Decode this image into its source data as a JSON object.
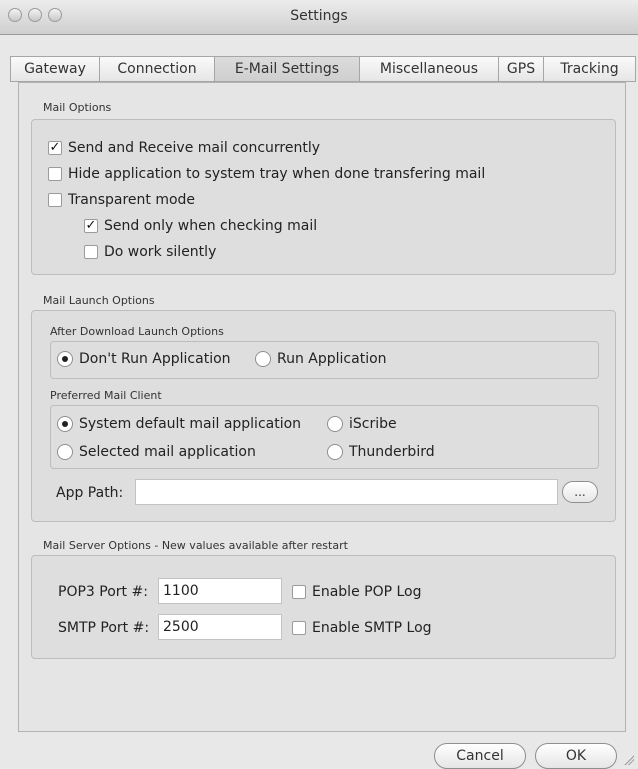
{
  "window": {
    "title": "Settings"
  },
  "tabs": [
    {
      "label": "Gateway",
      "active": false
    },
    {
      "label": "Connection",
      "active": false
    },
    {
      "label": "E-Mail Settings",
      "active": true
    },
    {
      "label": "Miscellaneous",
      "active": false
    },
    {
      "label": "GPS",
      "active": false
    },
    {
      "label": "Tracking",
      "active": false
    }
  ],
  "mail_options": {
    "title": "Mail Options",
    "items": [
      {
        "label": "Send and Receive mail concurrently",
        "checked": true
      },
      {
        "label": "Hide application to system tray when done transfering mail",
        "checked": false
      },
      {
        "label": "Transparent mode",
        "checked": false
      },
      {
        "label": "Send only when checking mail",
        "checked": true
      },
      {
        "label": "Do work silently",
        "checked": false
      }
    ]
  },
  "mail_launch": {
    "title": "Mail Launch Options",
    "after_download": {
      "title": "After Download Launch Options",
      "options": [
        {
          "label": "Don't Run Application",
          "selected": true
        },
        {
          "label": "Run Application",
          "selected": false
        }
      ]
    },
    "preferred_client": {
      "title": "Preferred Mail Client",
      "options": [
        {
          "label": "System default mail application",
          "selected": true
        },
        {
          "label": "iScribe",
          "selected": false
        },
        {
          "label": "Selected mail application",
          "selected": false
        },
        {
          "label": "Thunderbird",
          "selected": false
        }
      ]
    },
    "app_path": {
      "label": "App Path:",
      "value": "",
      "browse_label": "..."
    }
  },
  "mail_server": {
    "title": "Mail Server Options - New values available after restart",
    "pop3": {
      "label": "POP3 Port #:",
      "value": "1100",
      "log_label": "Enable POP Log",
      "log_checked": false
    },
    "smtp": {
      "label": "SMTP Port #:",
      "value": "2500",
      "log_label": "Enable SMTP Log",
      "log_checked": false
    }
  },
  "footer": {
    "cancel": "Cancel",
    "ok": "OK"
  }
}
